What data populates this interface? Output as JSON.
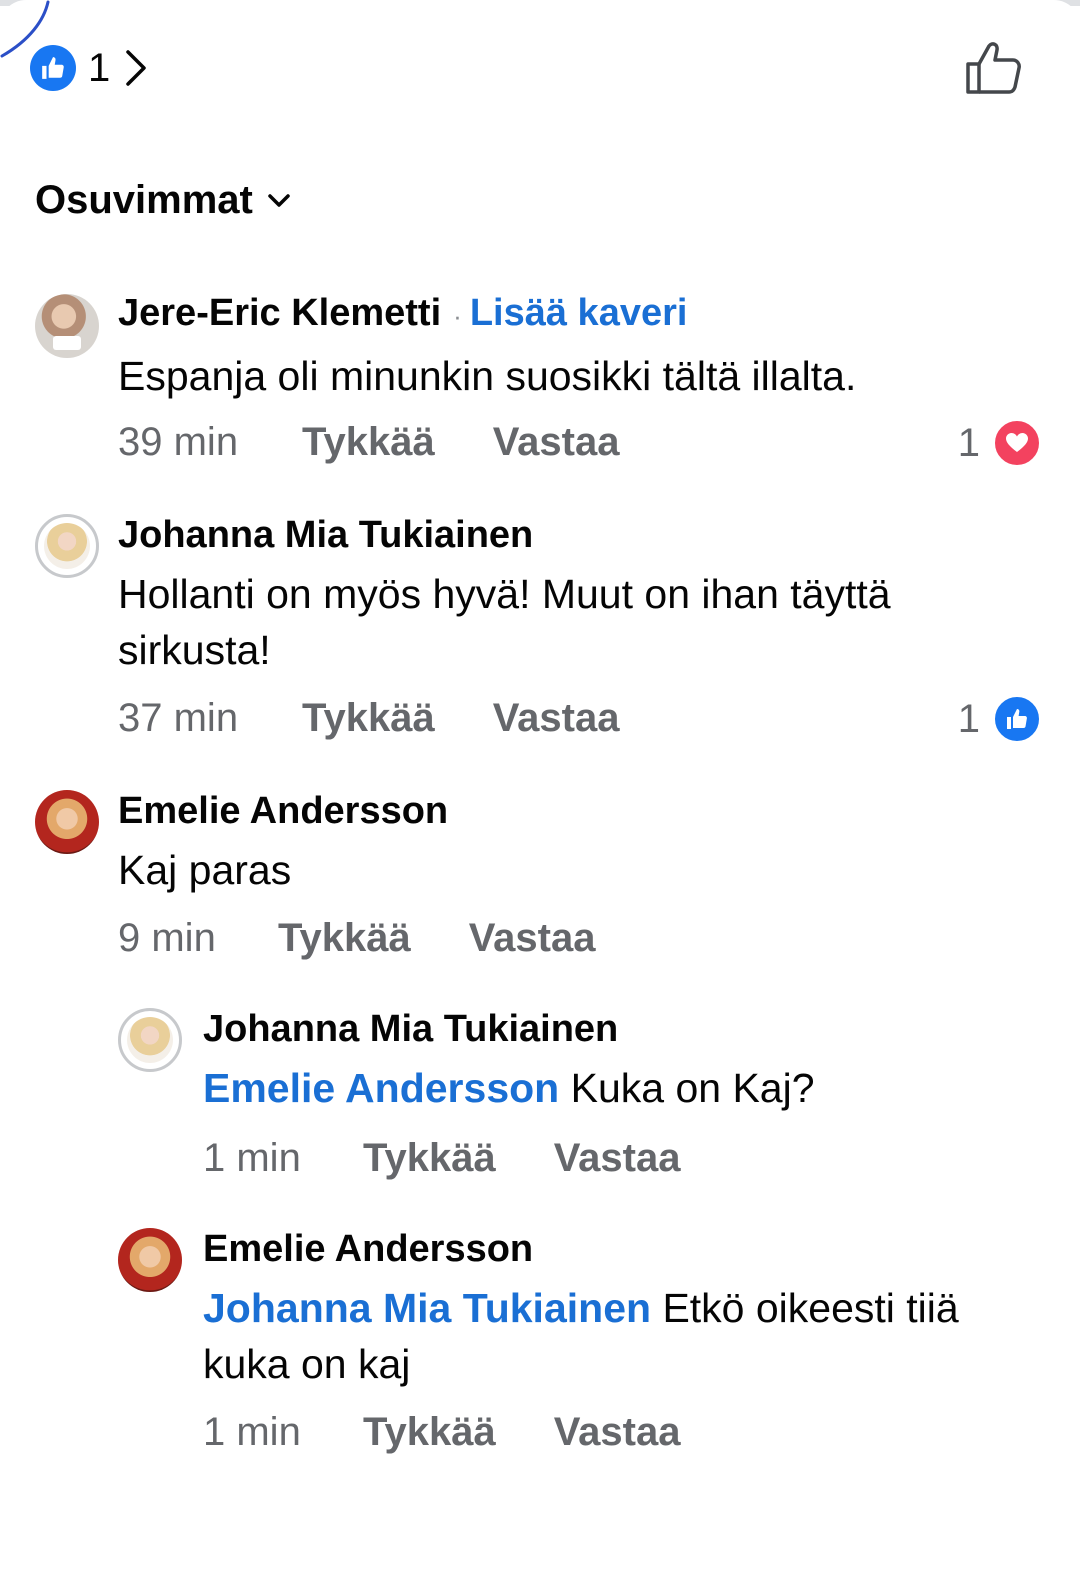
{
  "header": {
    "reaction_count": "1",
    "reaction_icon": "like-badge-icon",
    "like_button_icon": "like-outline-icon",
    "accent": "#1877f2"
  },
  "sort": {
    "label": "Osuvimmat"
  },
  "comments": [
    {
      "author": "Jere-Eric Klemetti",
      "add_friend": "Lisää kaveri",
      "text": "Espanja oli minunkin suosikki tältä illalta.",
      "time": "39 min",
      "like_label": "Tykkää",
      "reply_label": "Vastaa",
      "reaction_count": "1",
      "reaction_icon": "heart-reaction-icon"
    },
    {
      "author": "Johanna Mia Tukiainen",
      "text": "Hollanti on myös hyvä! Muut on ihan täyttä sirkusta!",
      "time": "37 min",
      "like_label": "Tykkää",
      "reply_label": "Vastaa",
      "reaction_count": "1",
      "reaction_icon": "like-reaction-icon"
    },
    {
      "author": "Emelie Andersson",
      "text": "Kaj paras",
      "time": "9 min",
      "like_label": "Tykkää",
      "reply_label": "Vastaa",
      "replies": [
        {
          "author": "Johanna Mia Tukiainen",
          "mention": "Emelie Andersson",
          "text": " Kuka on Kaj?",
          "time": "1 min",
          "like_label": "Tykkää",
          "reply_label": "Vastaa"
        },
        {
          "author": "Emelie Andersson",
          "mention": "Johanna Mia Tukiainen",
          "text": " Etkö oikeesti tiiä kuka on kaj",
          "time": "1 min",
          "like_label": "Tykkää",
          "reply_label": "Vastaa"
        }
      ]
    }
  ]
}
